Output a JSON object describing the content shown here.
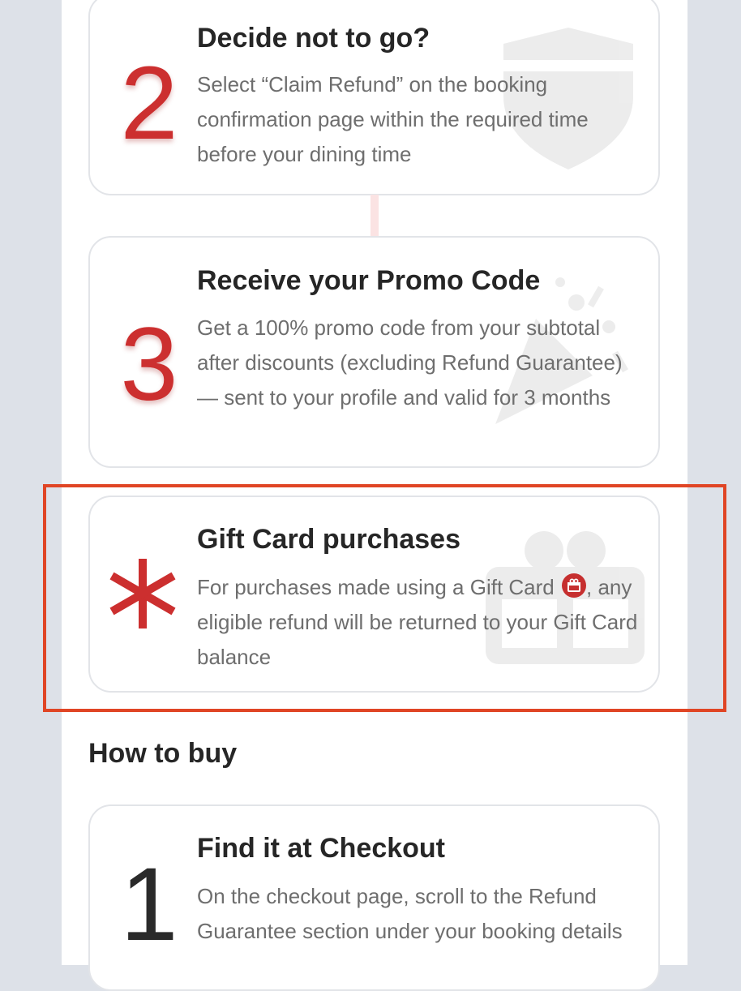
{
  "steps": [
    {
      "number": "2",
      "title": "Decide not to go?",
      "body": "Select “Claim Refund” on the booking confirmation page within the required time before your dining time",
      "watermark_icon": "shield-icon"
    },
    {
      "number": "3",
      "title": "Receive your Promo Code",
      "body": "Get a 100% promo code from your subtotal after discounts (excluding Refund Guarantee) — sent to your profile and valid for 3 months",
      "watermark_icon": "party-popper-icon"
    }
  ],
  "gift_card": {
    "marker": "asterisk-icon",
    "title": "Gift Card purchases",
    "body_before_icon": "For purchases made using a Gift Card",
    "inline_icon": "gift-card-icon",
    "body_after_icon": ", any eligible refund will be returned to your Gift Card balance",
    "watermark_icon": "gift-box-icon"
  },
  "how_to_buy": {
    "heading": "How to buy",
    "steps": [
      {
        "number": "1",
        "title": "Find it at Checkout",
        "body": "On the checkout page, scroll to the Refund Guarantee section under your booking details"
      }
    ]
  },
  "colors": {
    "accent_red": "#cc2f2f",
    "highlight_border": "#e04525",
    "page_bg": "#dde1e8",
    "card_border": "#e2e4e8",
    "body_text": "#6e6e6e",
    "title_text": "#262626"
  }
}
